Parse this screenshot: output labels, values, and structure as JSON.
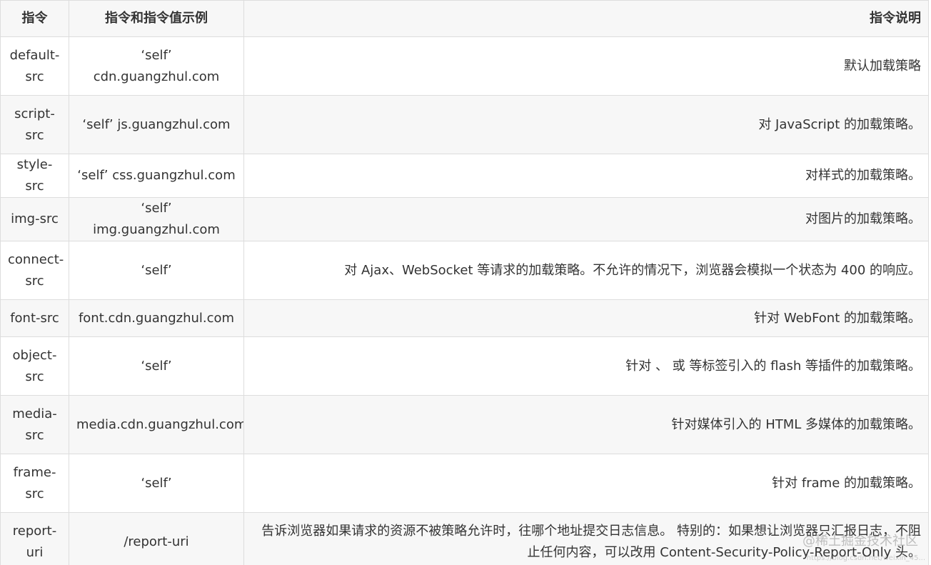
{
  "table": {
    "headers": {
      "directive": "指令",
      "example": "指令和指令值示例",
      "description": "指令说明"
    },
    "rows": [
      {
        "directive": "default-src",
        "example": "‘self’ cdn.guangzhul.com",
        "description": "默认加载策略"
      },
      {
        "directive": "script-src",
        "example": "‘self’ js.guangzhul.com",
        "description": "对 JavaScript 的加载策略。"
      },
      {
        "directive": "style-src",
        "example": "‘self’ css.guangzhul.com",
        "description": "对样式的加载策略。"
      },
      {
        "directive": "img-src",
        "example": "‘self’ img.guangzhul.com",
        "description": "对图片的加载策略。"
      },
      {
        "directive": "connect-src",
        "example": "‘self’",
        "description": "对 Ajax、WebSocket 等请求的加载策略。不允许的情况下，浏览器会模拟一个状态为 400 的响应。"
      },
      {
        "directive": "font-src",
        "example": "font.cdn.guangzhul.com",
        "description": "针对 WebFont 的加载策略。"
      },
      {
        "directive": "object-src",
        "example": "‘self’",
        "description": "针对 、 或 等标签引入的 flash 等插件的加载策略。"
      },
      {
        "directive": "media-src",
        "example": "media.cdn.guangzhul.com",
        "description": "针对媒体引入的 HTML 多媒体的加载策略。"
      },
      {
        "directive": "frame-src",
        "example": "‘self’",
        "description": "针对 frame 的加载策略。"
      },
      {
        "directive": "report-uri",
        "example": "/report-uri",
        "description": "告诉浏览器如果请求的资源不被策略允许时，往哪个地址提交日志信息。 特别的：如果想让浏览器只汇报日志，不阻止任何内容，可以改用 Content-Security-Policy-Report-Only 头。"
      }
    ]
  },
  "watermark": {
    "text": "@稀土掘金技术社区",
    "sub": "https://blog.csdn.net/weixin_45..."
  }
}
